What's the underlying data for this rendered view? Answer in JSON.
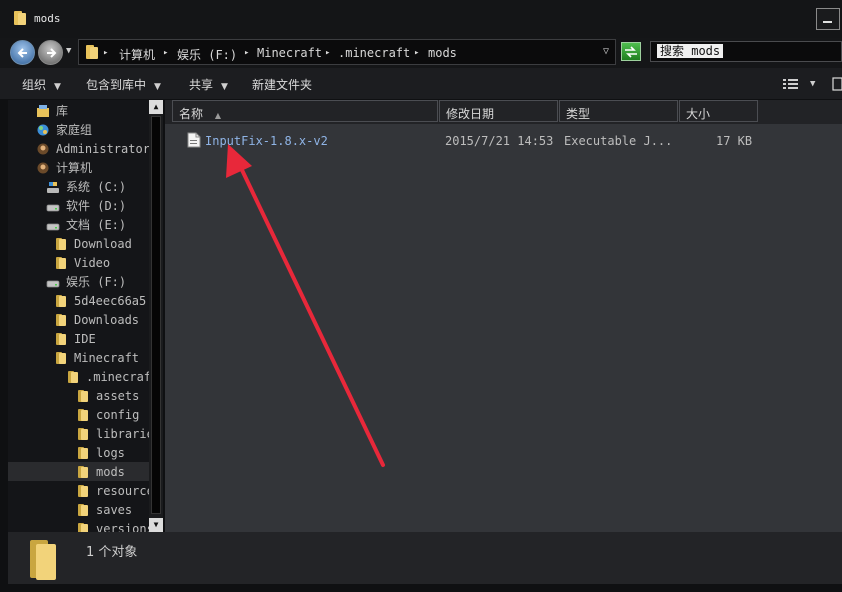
{
  "window": {
    "title": "mods"
  },
  "address": {
    "crumbs": [
      "计算机",
      "娱乐 (F:)",
      "Minecraft",
      ".minecraft",
      "mods"
    ],
    "sep": "▸"
  },
  "search": {
    "placeholder": "搜索 mods"
  },
  "toolbar": {
    "organize": "组织",
    "include_in_library": "包含到库中",
    "share": "共享",
    "new_folder": "新建文件夹"
  },
  "nav_tree": [
    {
      "label": "库",
      "indent": 0,
      "icon": "library-icon"
    },
    {
      "label": "家庭组",
      "indent": 0,
      "icon": "homegroup-icon"
    },
    {
      "label": "Administrator",
      "indent": 0,
      "icon": "user-icon"
    },
    {
      "label": "计算机",
      "indent": 0,
      "icon": "computer-icon"
    },
    {
      "label": "系统 (C:)",
      "indent": 1,
      "icon": "system-drive-icon"
    },
    {
      "label": "软件 (D:)",
      "indent": 1,
      "icon": "drive-icon"
    },
    {
      "label": "文档 (E:)",
      "indent": 1,
      "icon": "drive-icon"
    },
    {
      "label": "Download",
      "indent": 2,
      "icon": "folder-icon"
    },
    {
      "label": "Video",
      "indent": 2,
      "icon": "folder-icon"
    },
    {
      "label": "娱乐 (F:)",
      "indent": 1,
      "icon": "drive-icon"
    },
    {
      "label": "5d4eec66a5",
      "indent": 2,
      "icon": "folder-icon"
    },
    {
      "label": "Downloads",
      "indent": 2,
      "icon": "folder-icon"
    },
    {
      "label": "IDE",
      "indent": 2,
      "icon": "folder-icon"
    },
    {
      "label": "Minecraft",
      "indent": 2,
      "icon": "folder-icon"
    },
    {
      "label": ".minecraft",
      "indent": 3,
      "icon": "folder-icon"
    },
    {
      "label": "assets",
      "indent": 4,
      "icon": "folder-icon"
    },
    {
      "label": "config",
      "indent": 4,
      "icon": "folder-icon"
    },
    {
      "label": "libraries",
      "indent": 4,
      "icon": "folder-icon"
    },
    {
      "label": "logs",
      "indent": 4,
      "icon": "folder-icon"
    },
    {
      "label": "mods",
      "indent": 4,
      "icon": "folder-icon",
      "selected": true
    },
    {
      "label": "resourcepacks",
      "indent": 4,
      "icon": "folder-icon"
    },
    {
      "label": "saves",
      "indent": 4,
      "icon": "folder-icon"
    },
    {
      "label": "versions",
      "indent": 4,
      "icon": "folder-icon"
    }
  ],
  "columns": {
    "name": "名称",
    "modified": "修改日期",
    "type": "类型",
    "size": "大小"
  },
  "files": [
    {
      "name": "InputFix-1.8.x-v2",
      "modified": "2015/7/21 14:53",
      "type": "Executable J...",
      "size": "17 KB"
    }
  ],
  "status": {
    "count": "1 个对象"
  },
  "colors": {
    "folder": "#e8c25a",
    "arrow": "#e8283a",
    "accent": "#4f8fd6"
  }
}
